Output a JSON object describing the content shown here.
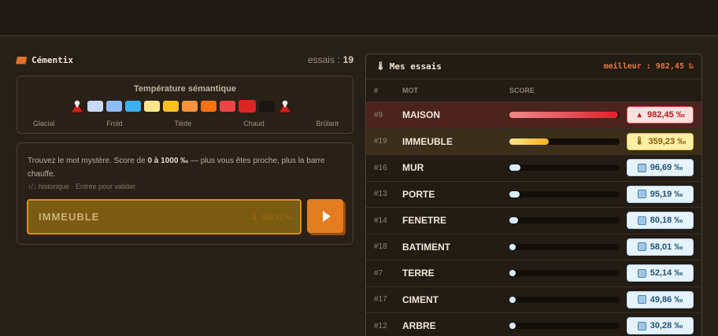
{
  "app": {
    "name": "Cémentix",
    "essais_label": "essais :",
    "essais_count": "19"
  },
  "temperature": {
    "title": "Température sémantique",
    "swatches": [
      "#c7d9f6",
      "#8ebdf5",
      "#3bb1ef",
      "#fde58b",
      "#fbbf24",
      "#fb923c",
      "#f97316",
      "#ef4444",
      "#dc2626",
      "#1a1510"
    ],
    "labels": [
      "Glacial",
      "Froid",
      "Tiède",
      "Chaud",
      "Brûlant"
    ]
  },
  "guess": {
    "help_prefix": "Trouvez le mot mystère. Score de ",
    "help_range": "0 à 1000 ‰",
    "help_suffix": " — plus vous êtes proche, plus la barre chauffe.",
    "hint": "↑/↓ historique · Entrée pour valider",
    "input_value": "IMMEUBLE",
    "input_score": "359,23 ‰"
  },
  "panel": {
    "title": "Mes essais",
    "best": "meilleur : 982,45 ‰",
    "col_num": "#",
    "col_word": "MOT",
    "col_score": "SCORE"
  },
  "rows": [
    {
      "num": "#9",
      "word": "MAISON",
      "score": "982,45 ‰",
      "fill": 0.9825,
      "tier": "hot"
    },
    {
      "num": "#19",
      "word": "IMMEUBLE",
      "score": "359,23 ‰",
      "fill": 0.3592,
      "tier": "warm"
    },
    {
      "num": "#16",
      "word": "MUR",
      "score": "96,69 ‰",
      "fill": 0.0967,
      "tier": "cold"
    },
    {
      "num": "#13",
      "word": "PORTE",
      "score": "95,19 ‰",
      "fill": 0.0952,
      "tier": "cold"
    },
    {
      "num": "#14",
      "word": "FENETRE",
      "score": "80,18 ‰",
      "fill": 0.0802,
      "tier": "cold"
    },
    {
      "num": "#18",
      "word": "BATIMENT",
      "score": "58,01 ‰",
      "fill": 0.058,
      "tier": "cold"
    },
    {
      "num": "#7",
      "word": "TERRE",
      "score": "52,14 ‰",
      "fill": 0.0521,
      "tier": "cold"
    },
    {
      "num": "#17",
      "word": "CIMENT",
      "score": "49,86 ‰",
      "fill": 0.0499,
      "tier": "cold"
    },
    {
      "num": "#12",
      "word": "ARBRE",
      "score": "30,28 ‰",
      "fill": 0.0303,
      "tier": "cold"
    }
  ]
}
